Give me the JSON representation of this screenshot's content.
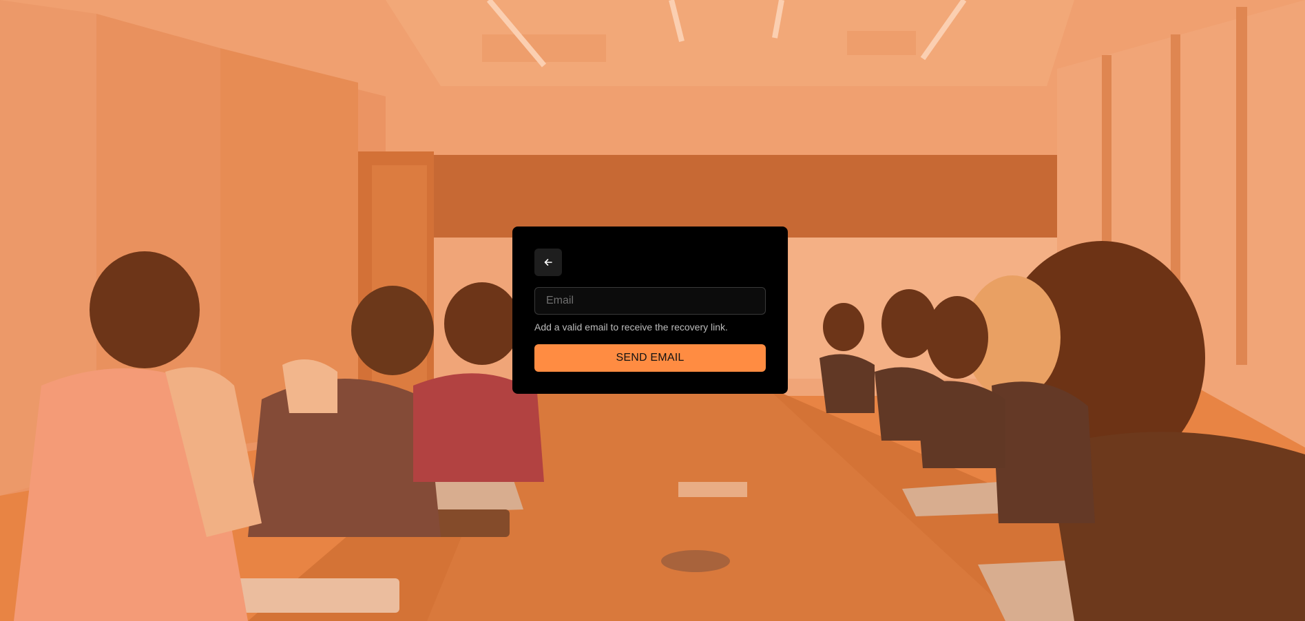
{
  "background": {
    "description_icon": "meeting-room-photo"
  },
  "colors": {
    "accent": "#ff8c42",
    "card_bg": "#000000",
    "back_button_bg": "#1e1e1e"
  },
  "form": {
    "back_icon": "arrow-left-icon",
    "email_placeholder": "Email",
    "email_value": "",
    "helper_text": "Add a valid email to receive the recovery link.",
    "send_label": "SEND EMAIL"
  }
}
